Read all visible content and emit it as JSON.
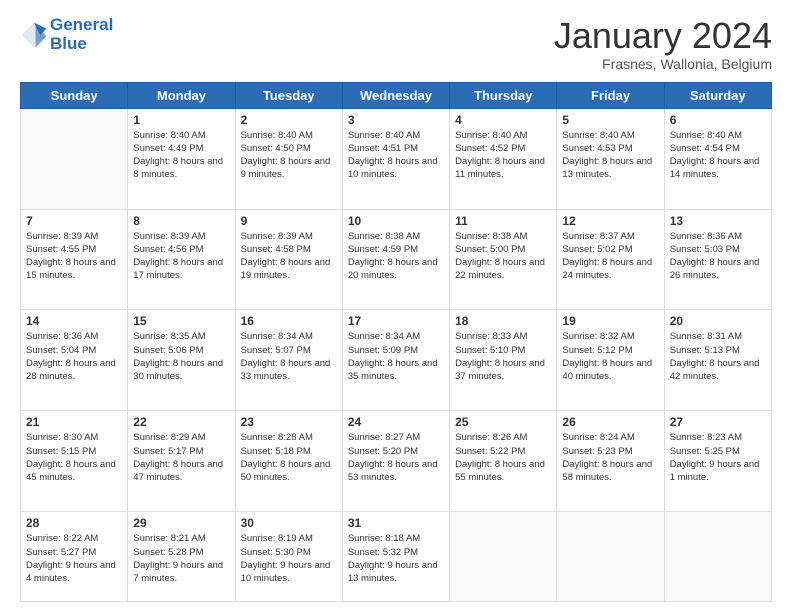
{
  "logo": {
    "line1": "General",
    "line2": "Blue"
  },
  "title": "January 2024",
  "subtitle": "Frasnes, Wallonia, Belgium",
  "days_header": [
    "Sunday",
    "Monday",
    "Tuesday",
    "Wednesday",
    "Thursday",
    "Friday",
    "Saturday"
  ],
  "weeks": [
    [
      {
        "day": "",
        "sunrise": "",
        "sunset": "",
        "daylight": ""
      },
      {
        "day": "1",
        "sunrise": "Sunrise: 8:40 AM",
        "sunset": "Sunset: 4:49 PM",
        "daylight": "Daylight: 8 hours and 8 minutes."
      },
      {
        "day": "2",
        "sunrise": "Sunrise: 8:40 AM",
        "sunset": "Sunset: 4:50 PM",
        "daylight": "Daylight: 8 hours and 9 minutes."
      },
      {
        "day": "3",
        "sunrise": "Sunrise: 8:40 AM",
        "sunset": "Sunset: 4:51 PM",
        "daylight": "Daylight: 8 hours and 10 minutes."
      },
      {
        "day": "4",
        "sunrise": "Sunrise: 8:40 AM",
        "sunset": "Sunset: 4:52 PM",
        "daylight": "Daylight: 8 hours and 11 minutes."
      },
      {
        "day": "5",
        "sunrise": "Sunrise: 8:40 AM",
        "sunset": "Sunset: 4:53 PM",
        "daylight": "Daylight: 8 hours and 13 minutes."
      },
      {
        "day": "6",
        "sunrise": "Sunrise: 8:40 AM",
        "sunset": "Sunset: 4:54 PM",
        "daylight": "Daylight: 8 hours and 14 minutes."
      }
    ],
    [
      {
        "day": "7",
        "sunrise": "Sunrise: 8:39 AM",
        "sunset": "Sunset: 4:55 PM",
        "daylight": "Daylight: 8 hours and 15 minutes."
      },
      {
        "day": "8",
        "sunrise": "Sunrise: 8:39 AM",
        "sunset": "Sunset: 4:56 PM",
        "daylight": "Daylight: 8 hours and 17 minutes."
      },
      {
        "day": "9",
        "sunrise": "Sunrise: 8:39 AM",
        "sunset": "Sunset: 4:58 PM",
        "daylight": "Daylight: 8 hours and 19 minutes."
      },
      {
        "day": "10",
        "sunrise": "Sunrise: 8:38 AM",
        "sunset": "Sunset: 4:59 PM",
        "daylight": "Daylight: 8 hours and 20 minutes."
      },
      {
        "day": "11",
        "sunrise": "Sunrise: 8:38 AM",
        "sunset": "Sunset: 5:00 PM",
        "daylight": "Daylight: 8 hours and 22 minutes."
      },
      {
        "day": "12",
        "sunrise": "Sunrise: 8:37 AM",
        "sunset": "Sunset: 5:02 PM",
        "daylight": "Daylight: 8 hours and 24 minutes."
      },
      {
        "day": "13",
        "sunrise": "Sunrise: 8:36 AM",
        "sunset": "Sunset: 5:03 PM",
        "daylight": "Daylight: 8 hours and 26 minutes."
      }
    ],
    [
      {
        "day": "14",
        "sunrise": "Sunrise: 8:36 AM",
        "sunset": "Sunset: 5:04 PM",
        "daylight": "Daylight: 8 hours and 28 minutes."
      },
      {
        "day": "15",
        "sunrise": "Sunrise: 8:35 AM",
        "sunset": "Sunset: 5:06 PM",
        "daylight": "Daylight: 8 hours and 30 minutes."
      },
      {
        "day": "16",
        "sunrise": "Sunrise: 8:34 AM",
        "sunset": "Sunset: 5:07 PM",
        "daylight": "Daylight: 8 hours and 33 minutes."
      },
      {
        "day": "17",
        "sunrise": "Sunrise: 8:34 AM",
        "sunset": "Sunset: 5:09 PM",
        "daylight": "Daylight: 8 hours and 35 minutes."
      },
      {
        "day": "18",
        "sunrise": "Sunrise: 8:33 AM",
        "sunset": "Sunset: 5:10 PM",
        "daylight": "Daylight: 8 hours and 37 minutes."
      },
      {
        "day": "19",
        "sunrise": "Sunrise: 8:32 AM",
        "sunset": "Sunset: 5:12 PM",
        "daylight": "Daylight: 8 hours and 40 minutes."
      },
      {
        "day": "20",
        "sunrise": "Sunrise: 8:31 AM",
        "sunset": "Sunset: 5:13 PM",
        "daylight": "Daylight: 8 hours and 42 minutes."
      }
    ],
    [
      {
        "day": "21",
        "sunrise": "Sunrise: 8:30 AM",
        "sunset": "Sunset: 5:15 PM",
        "daylight": "Daylight: 8 hours and 45 minutes."
      },
      {
        "day": "22",
        "sunrise": "Sunrise: 8:29 AM",
        "sunset": "Sunset: 5:17 PM",
        "daylight": "Daylight: 8 hours and 47 minutes."
      },
      {
        "day": "23",
        "sunrise": "Sunrise: 8:28 AM",
        "sunset": "Sunset: 5:18 PM",
        "daylight": "Daylight: 8 hours and 50 minutes."
      },
      {
        "day": "24",
        "sunrise": "Sunrise: 8:27 AM",
        "sunset": "Sunset: 5:20 PM",
        "daylight": "Daylight: 8 hours and 53 minutes."
      },
      {
        "day": "25",
        "sunrise": "Sunrise: 8:26 AM",
        "sunset": "Sunset: 5:22 PM",
        "daylight": "Daylight: 8 hours and 55 minutes."
      },
      {
        "day": "26",
        "sunrise": "Sunrise: 8:24 AM",
        "sunset": "Sunset: 5:23 PM",
        "daylight": "Daylight: 8 hours and 58 minutes."
      },
      {
        "day": "27",
        "sunrise": "Sunrise: 8:23 AM",
        "sunset": "Sunset: 5:25 PM",
        "daylight": "Daylight: 9 hours and 1 minute."
      }
    ],
    [
      {
        "day": "28",
        "sunrise": "Sunrise: 8:22 AM",
        "sunset": "Sunset: 5:27 PM",
        "daylight": "Daylight: 9 hours and 4 minutes."
      },
      {
        "day": "29",
        "sunrise": "Sunrise: 8:21 AM",
        "sunset": "Sunset: 5:28 PM",
        "daylight": "Daylight: 9 hours and 7 minutes."
      },
      {
        "day": "30",
        "sunrise": "Sunrise: 8:19 AM",
        "sunset": "Sunset: 5:30 PM",
        "daylight": "Daylight: 9 hours and 10 minutes."
      },
      {
        "day": "31",
        "sunrise": "Sunrise: 8:18 AM",
        "sunset": "Sunset: 5:32 PM",
        "daylight": "Daylight: 9 hours and 13 minutes."
      },
      {
        "day": "",
        "sunrise": "",
        "sunset": "",
        "daylight": ""
      },
      {
        "day": "",
        "sunrise": "",
        "sunset": "",
        "daylight": ""
      },
      {
        "day": "",
        "sunrise": "",
        "sunset": "",
        "daylight": ""
      }
    ]
  ]
}
